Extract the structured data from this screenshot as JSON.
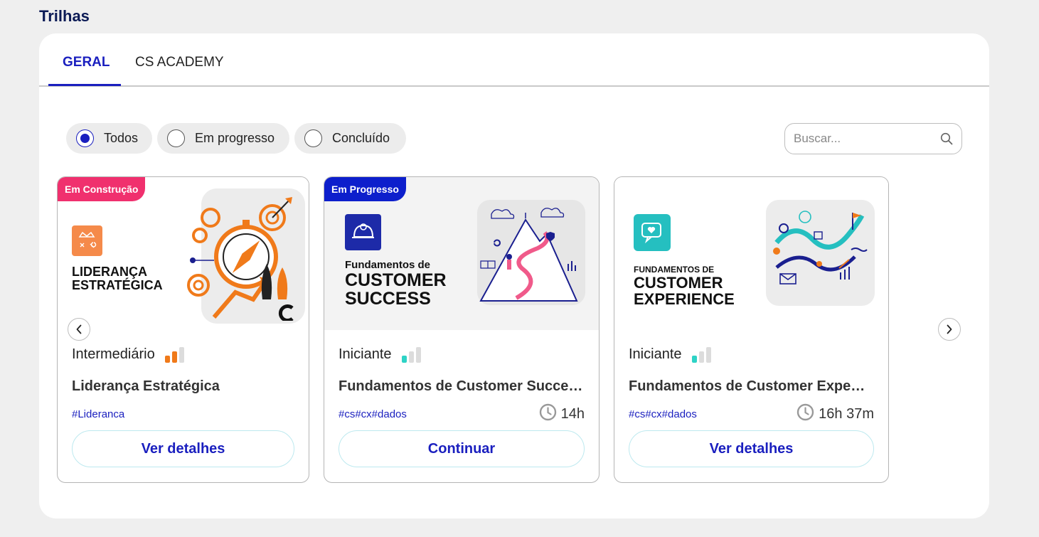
{
  "page": {
    "title": "Trilhas"
  },
  "tabs": [
    {
      "label": "GERAL",
      "active": true
    },
    {
      "label": "CS ACADEMY",
      "active": false
    }
  ],
  "filters": [
    {
      "label": "Todos",
      "checked": true
    },
    {
      "label": "Em progresso",
      "checked": false
    },
    {
      "label": "Concluído",
      "checked": false
    }
  ],
  "search": {
    "placeholder": "Buscar..."
  },
  "colors": {
    "accent": "#1a1fbf",
    "badge_construction": "#f0306e",
    "badge_progress": "#0d1fcc",
    "level_orange": "#f07a1a",
    "level_teal": "#2ed3c6"
  },
  "cards": [
    {
      "badge": "Em Construção",
      "art_title_line1": "LIDERANÇA",
      "art_title_line2": "ESTRATÉGICA",
      "level": "Intermediário",
      "level_filled": 2,
      "title": "Liderança Estratégica",
      "tags": "#Lideranca",
      "duration": "",
      "button": "Ver detalhes"
    },
    {
      "badge": "Em Progresso",
      "art_title_line1": "Fundamentos de",
      "art_title_line2": "CUSTOMER",
      "art_title_line3": "SUCCESS",
      "level": "Iniciante",
      "level_filled": 1,
      "title": "Fundamentos de Customer Success",
      "tags": "#cs#cx#dados",
      "duration": "14h",
      "button": "Continuar"
    },
    {
      "badge": "",
      "art_title_line1": "FUNDAMENTOS DE",
      "art_title_line2": "CUSTOMER",
      "art_title_line3": "EXPERIENCE",
      "level": "Iniciante",
      "level_filled": 1,
      "title": "Fundamentos de Customer Experience",
      "tags": "#cs#cx#dados",
      "duration": "16h 37m",
      "button": "Ver detalhes"
    }
  ]
}
